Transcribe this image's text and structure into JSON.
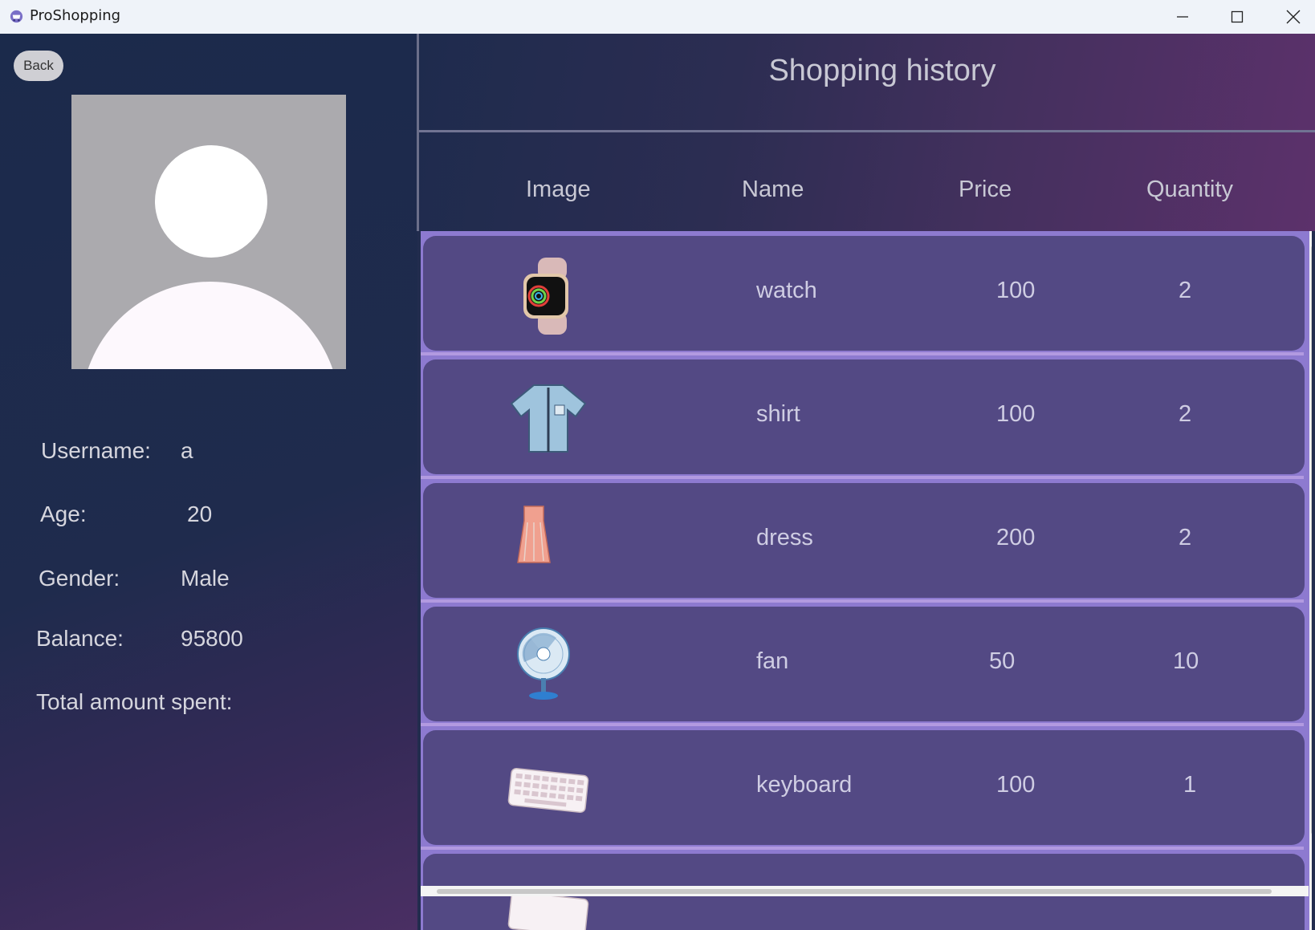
{
  "window": {
    "title": "ProShopping",
    "minimize_icon": "minimize-icon",
    "maximize_icon": "maximize-icon",
    "close_icon": "close-icon"
  },
  "profile": {
    "back_label": "Back",
    "avatar_icon": "user-avatar-placeholder",
    "fields": [
      {
        "label": "Username:",
        "value": "a"
      },
      {
        "label": "Age:",
        "value": "20"
      },
      {
        "label": "Gender:",
        "value": "Male"
      },
      {
        "label": "Balance:",
        "value": "95800"
      },
      {
        "label": "Total amount spent:",
        "value": ""
      }
    ]
  },
  "history": {
    "title": "Shopping history",
    "columns": [
      "Image",
      "Name",
      "Price",
      "Quantity"
    ],
    "rows": [
      {
        "image": "watch-image",
        "name": "watch",
        "price": "100",
        "quantity": "2"
      },
      {
        "image": "shirt-image",
        "name": "shirt",
        "price": "100",
        "quantity": "2"
      },
      {
        "image": "dress-image",
        "name": "dress",
        "price": "200",
        "quantity": "2"
      },
      {
        "image": "fan-image",
        "name": "fan",
        "price": "50",
        "quantity": "10"
      },
      {
        "image": "keyboard-image",
        "name": "keyboard",
        "price": "100",
        "quantity": "1"
      }
    ]
  },
  "colors": {
    "left_bg": "#1b2a4b",
    "row_bg": "#534984",
    "row_separator": "#b29ae0",
    "header_text": "#c8c8d4"
  }
}
